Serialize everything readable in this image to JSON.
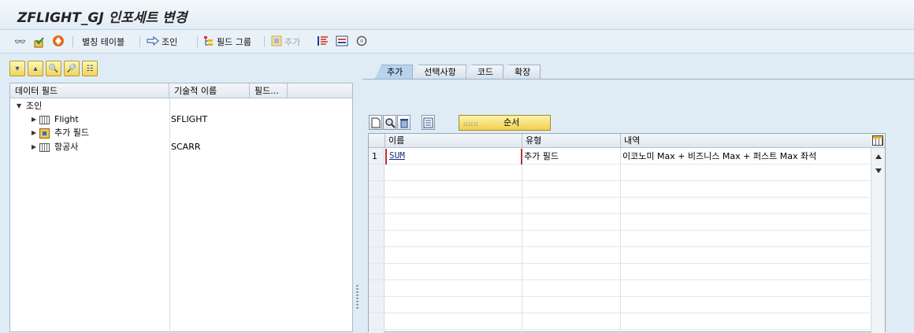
{
  "window": {
    "title": "ZFLIGHT_GJ 인포세트 변경"
  },
  "toolbar": {
    "alias_table_label": "별칭 테이블",
    "join_label": "조인",
    "field_group_label": "필드 그룹",
    "add_label": "추가"
  },
  "left_tree": {
    "headers": [
      "데이터 필드",
      "기술적 이름",
      "필드..."
    ],
    "root_label": "조인",
    "items": [
      {
        "label": "Flight",
        "tech": "SFLIGHT",
        "icon": "table-icon"
      },
      {
        "label": "추가 필드",
        "tech": "",
        "icon": "additional-field-icon"
      },
      {
        "label": "항공사",
        "tech": "SCARR",
        "icon": "table-icon"
      }
    ]
  },
  "right_tabs": [
    {
      "label": "추가",
      "active": true
    },
    {
      "label": "선택사항",
      "active": false
    },
    {
      "label": "코드",
      "active": false
    },
    {
      "label": "확장",
      "active": false
    }
  ],
  "grid_tools": {
    "order_button_label": "순서"
  },
  "grid": {
    "headers": [
      "이름",
      "유형",
      "내역"
    ],
    "rows": [
      {
        "num": "1",
        "name": "SUM",
        "type": "추가 필드",
        "desc": "이코노미 Max + 비즈니스 Max + 퍼스트 Max 좌석"
      }
    ]
  },
  "colors": {
    "background": "#dfebf5",
    "button_yellow": "#f2cf4f",
    "active_tab": "#b8d3ee",
    "selection_border": "#c03030"
  }
}
